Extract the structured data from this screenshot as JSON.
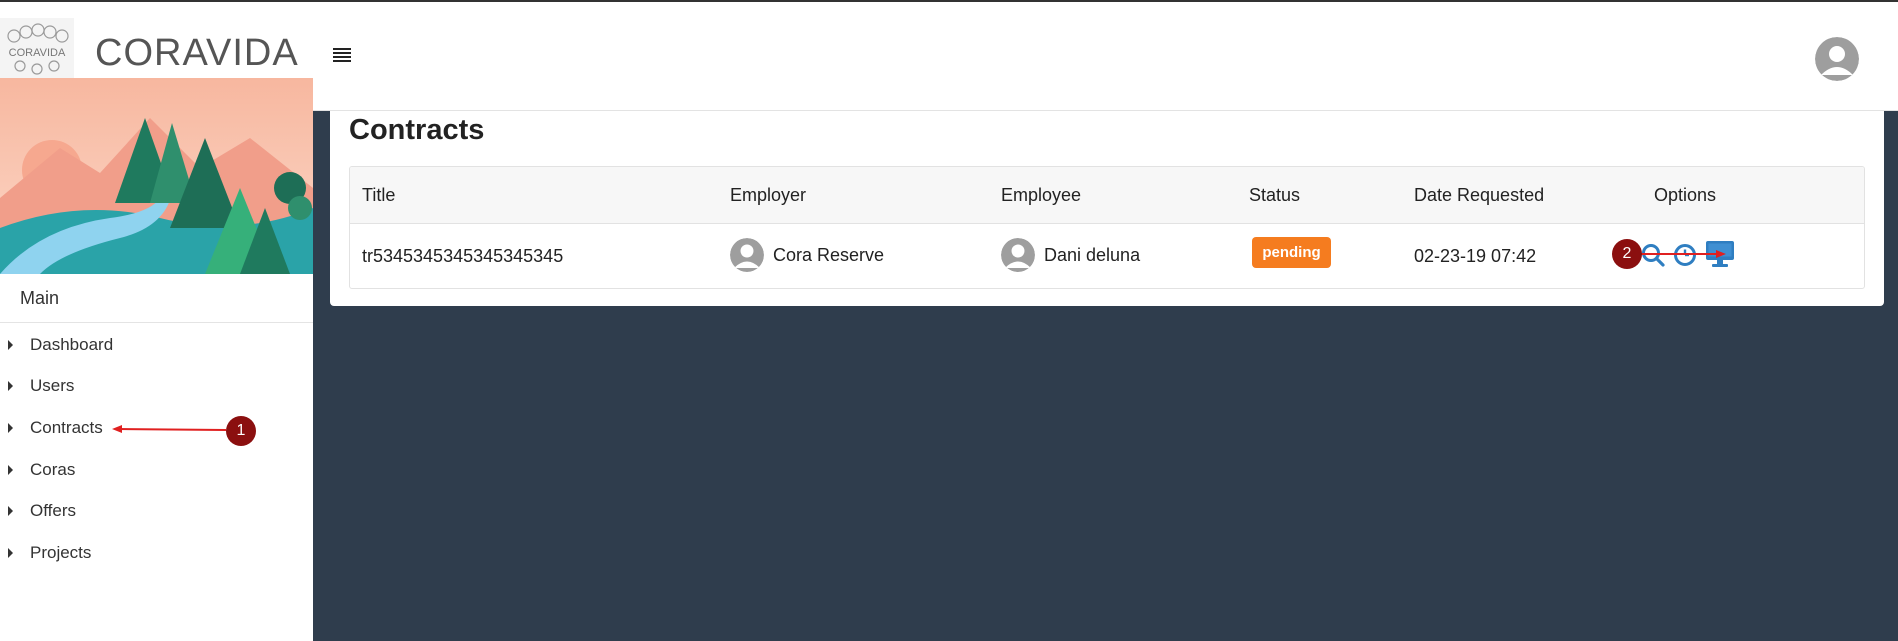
{
  "brand": {
    "name": "CORAVIDA",
    "logo_text": "CORAVIDA"
  },
  "sidebar": {
    "section_title": "Main",
    "items": [
      {
        "label": "Dashboard"
      },
      {
        "label": "Users"
      },
      {
        "label": "Contracts"
      },
      {
        "label": "Coras"
      },
      {
        "label": "Offers"
      },
      {
        "label": "Projects"
      }
    ]
  },
  "header": {
    "menu_icon": "hamburger-icon",
    "avatar_icon": "user-avatar-icon"
  },
  "main": {
    "title": "Contracts",
    "table": {
      "columns": [
        "Title",
        "Employer",
        "Employee",
        "Status",
        "Date Requested",
        "Options"
      ],
      "rows": [
        {
          "title": "tr5345345345345345345",
          "employer": "Cora Reserve",
          "employee": "Dani deluna",
          "status": "pending",
          "date_requested": "02-23-19 07:42",
          "options": [
            "search-icon",
            "clock-icon",
            "monitor-icon"
          ]
        }
      ]
    }
  },
  "annotations": {
    "marker_1": "1",
    "marker_2": "2"
  },
  "colors": {
    "background": "#2f3d4d",
    "status_pending": "#f57c1f",
    "icon_blue": "#2f7ec1",
    "annotation_red": "#8b0f0f"
  }
}
